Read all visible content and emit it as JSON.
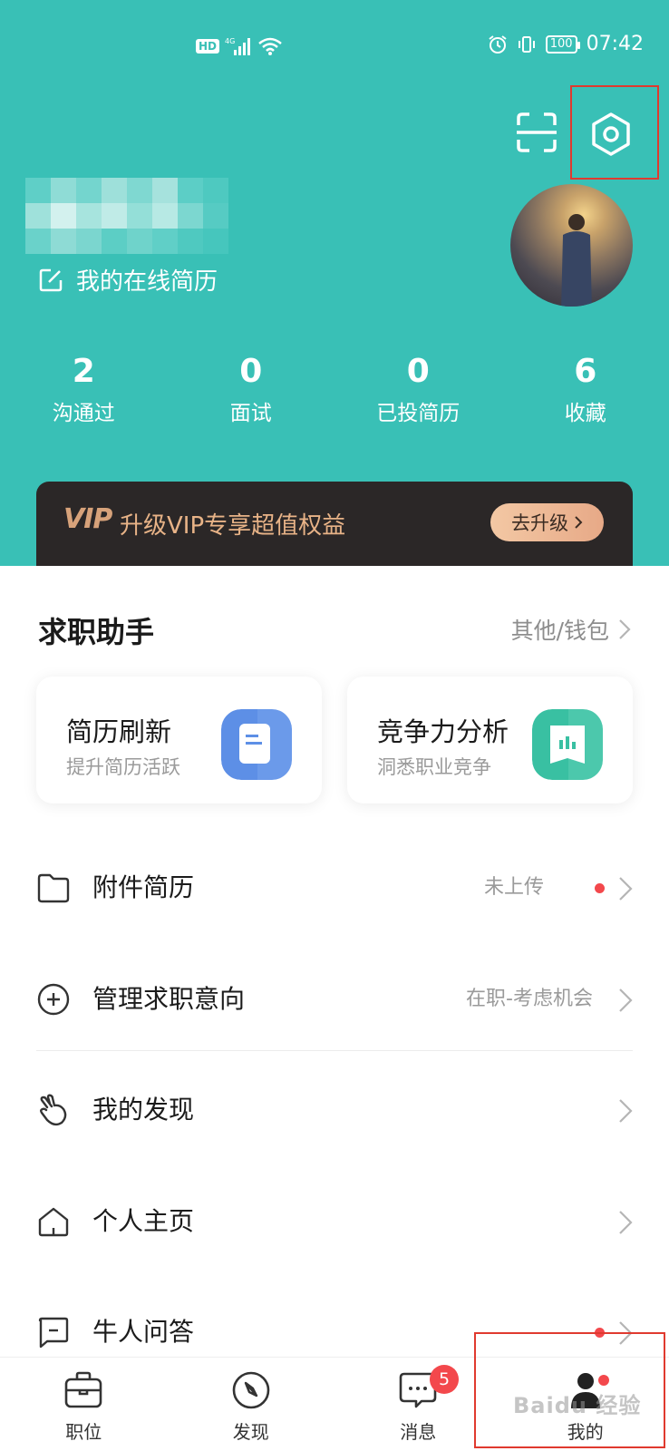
{
  "status_bar": {
    "hd": "HD",
    "network": "4G",
    "battery": "100",
    "time": "07:42"
  },
  "header": {
    "scan_icon": "scan-icon",
    "settings_icon": "settings-hexagon-icon",
    "online_resume": "我的在线简历",
    "accent": "#39c0b6"
  },
  "stats": [
    {
      "num": "2",
      "label": "沟通过"
    },
    {
      "num": "0",
      "label": "面试"
    },
    {
      "num": "0",
      "label": "已投简历"
    },
    {
      "num": "6",
      "label": "收藏"
    }
  ],
  "vip": {
    "logo": "VIP",
    "text": "升级VIP专享超值权益",
    "button": "去升级"
  },
  "assistant": {
    "title": "求职助手",
    "more": "其他/钱包",
    "cards": [
      {
        "title": "简历刷新",
        "subtitle": "提升简历活跃",
        "icon": "resume-refresh-icon"
      },
      {
        "title": "竞争力分析",
        "subtitle": "洞悉职业竞争",
        "icon": "competitiveness-chart-icon"
      }
    ]
  },
  "menu": [
    {
      "label": "附件简历",
      "value": "未上传",
      "icon": "folder-icon",
      "dot": true
    },
    {
      "label": "管理求职意向",
      "value": "在职-考虑机会",
      "icon": "plus-circle-icon",
      "dot": false
    },
    {
      "label": "我的发现",
      "value": "",
      "icon": "finger-heart-icon",
      "dot": false
    },
    {
      "label": "个人主页",
      "value": "",
      "icon": "home-icon",
      "dot": false
    },
    {
      "label": "牛人问答",
      "value": "",
      "icon": "message-box-icon",
      "dot": true
    }
  ],
  "tabs": [
    {
      "label": "职位",
      "icon": "briefcase-icon"
    },
    {
      "label": "发现",
      "icon": "compass-icon"
    },
    {
      "label": "消息",
      "icon": "chat-icon"
    },
    {
      "label": "我的",
      "icon": "profile-icon"
    }
  ],
  "message_badge": "5",
  "watermark": "Baidu 经验"
}
